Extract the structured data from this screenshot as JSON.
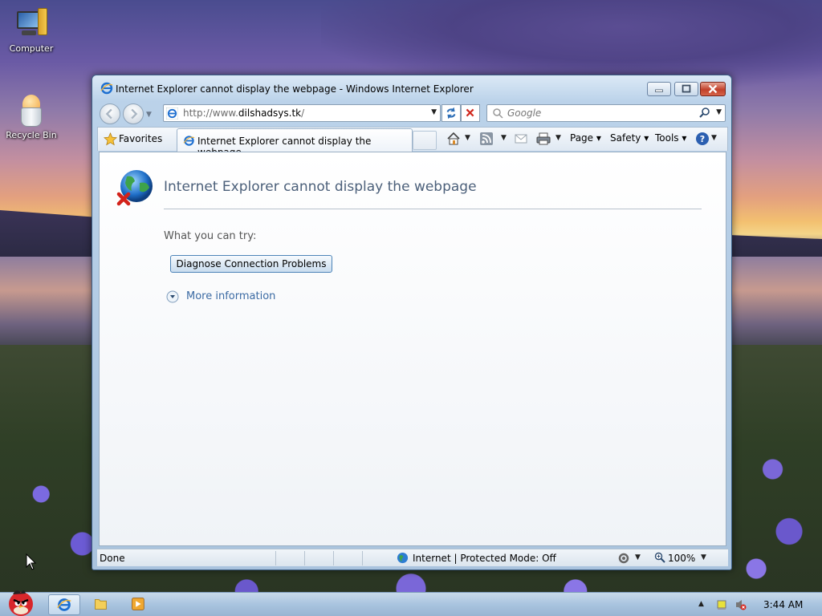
{
  "desktop": {
    "icons": [
      {
        "label": "Computer"
      },
      {
        "label": "Recycle Bin"
      }
    ]
  },
  "window": {
    "title": "Internet Explorer cannot display the webpage - Windows Internet Explorer",
    "address": {
      "prefix": "http://www.",
      "host": "dilshadsys.tk",
      "suffix": "/"
    },
    "search": {
      "placeholder": "Google"
    },
    "command_bar": {
      "favorites_label": "Favorites",
      "tab_label": "Internet Explorer cannot display the webpage",
      "page_label": "Page",
      "safety_label": "Safety",
      "tools_label": "Tools"
    },
    "content": {
      "heading": "Internet Explorer cannot display the webpage",
      "try_label": "What you can try:",
      "diagnose_button": "Diagnose Connection Problems",
      "more_info": "More information"
    },
    "status": {
      "left": "Done",
      "zone": "Internet | Protected Mode: Off",
      "zoom": "100%"
    }
  },
  "taskbar": {
    "clock": "3:44 AM"
  },
  "colors": {
    "title_blue": "#4c607a",
    "link_blue": "#3b6aa3",
    "close_red": "#c1402a"
  }
}
